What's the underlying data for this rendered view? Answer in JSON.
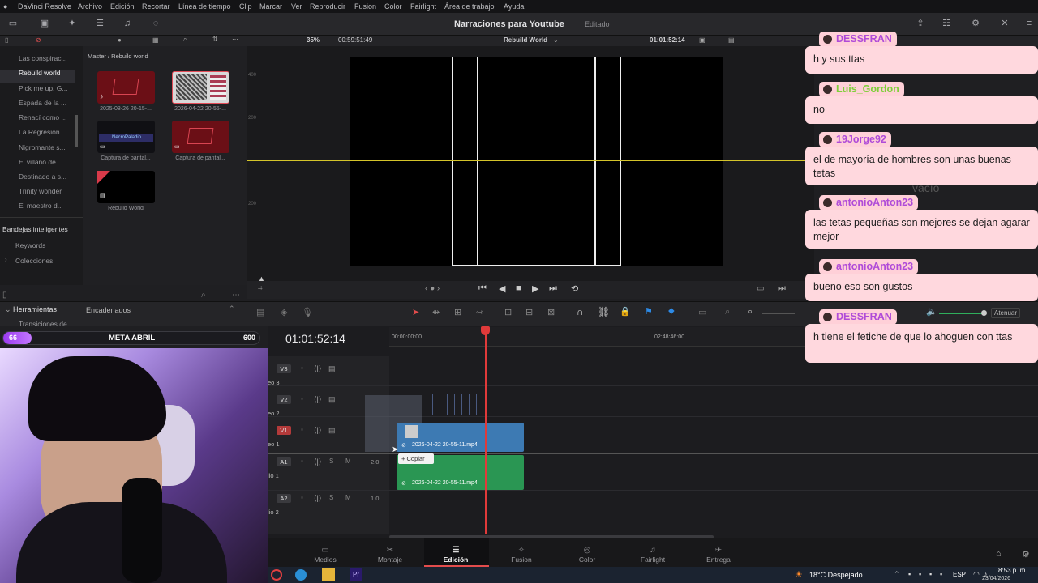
{
  "menu": {
    "app": "DaVinci Resolve",
    "items": [
      "Archivo",
      "Edición",
      "Recortar",
      "Línea de tiempo",
      "Clip",
      "Marcar",
      "Ver",
      "Reproducir",
      "Fusion",
      "Color",
      "Fairlight",
      "Área de trabajo",
      "Ayuda"
    ]
  },
  "header": {
    "project_title": "Narraciones para Youtube",
    "status": "Editado"
  },
  "subbar": {
    "zoom": "35%",
    "source_tc": "00:59:51:49",
    "timeline_name": "Rebuild World",
    "record_tc": "01:01:52:14"
  },
  "bins": [
    "Las conspirac...",
    "Rebuild world",
    "Pick me up, G...",
    "Espada de la ...",
    "Renací como ...",
    "La Regresión ...",
    "Nigromante s...",
    "El villano de ...",
    "Destinado a s...",
    "Trinity wonder",
    "El maestro d..."
  ],
  "smart_bins": {
    "title": "Bandejas inteligentes",
    "items": [
      "Keywords",
      "Colecciones"
    ]
  },
  "media_pool": {
    "breadcrumb": "Master / Rebuild world",
    "clips": [
      {
        "label": "2025-08-26 20-15-..."
      },
      {
        "label": "2026-04-22 20-55-..."
      },
      {
        "label": "Captura de pantal..."
      },
      {
        "label": "Captura de pantal..."
      },
      {
        "label": "Rebuild World"
      }
    ],
    "mini_text": "NecroPaladin"
  },
  "effects": {
    "tools_title": "Herramientas",
    "linked_title": "Encadenados",
    "item": "Transiciones de ..."
  },
  "goal_bar": {
    "current": "66",
    "label": "META ABRIL",
    "target": "600",
    "progress": 0.11
  },
  "timeline": {
    "timecode": "01:01:52:14",
    "ruler": [
      "00:00:00:00",
      "02:48:46:00"
    ],
    "tracks": [
      {
        "id": "V3",
        "name": "eo 3"
      },
      {
        "id": "V2",
        "name": "eo 2"
      },
      {
        "id": "V1",
        "name": "eo 1"
      },
      {
        "id": "A1",
        "name": "lio 1",
        "level": "2.0"
      },
      {
        "id": "A2",
        "name": "lio 2",
        "level": "1.0"
      }
    ],
    "video_clip": "2026-04-22 20-55-11.mp4",
    "audio_clip": "2026-04-22 20-55-11.mp4",
    "copy_tip": "Copiar",
    "audio_btn": "Atenuar"
  },
  "page_tabs": [
    "Medios",
    "Montaje",
    "Edición",
    "Fusion",
    "Color",
    "Fairlight",
    "Entrega"
  ],
  "active_tab": "Edición",
  "taskbar": {
    "weather": "18°C  Despejado",
    "lang": "ESP",
    "time": "8:53 p. m.",
    "date": "23/04/2026"
  },
  "chat": [
    {
      "user": "DESSFRAN",
      "color": "#b04bd8",
      "text": "h y sus ttas"
    },
    {
      "user": "Luis_Gordon",
      "color": "#7fd03a",
      "text": "no"
    },
    {
      "user": "19Jorge92",
      "color": "#b04bd8",
      "text": "el de mayoría de hombres son unas buenas tetas"
    },
    {
      "user": "antonioAnton23",
      "color": "#b04bd8",
      "text": "las tetas pequeñas son mejores se dejan agarar mejor"
    },
    {
      "user": "antonioAnton23",
      "color": "#b04bd8",
      "text": "bueno eso son gustos"
    },
    {
      "user": "DESSFRAN",
      "color": "#b04bd8",
      "text": "h tiene el fetiche de que lo ahoguen con ttas"
    }
  ],
  "viewer_watermark": "vacío"
}
